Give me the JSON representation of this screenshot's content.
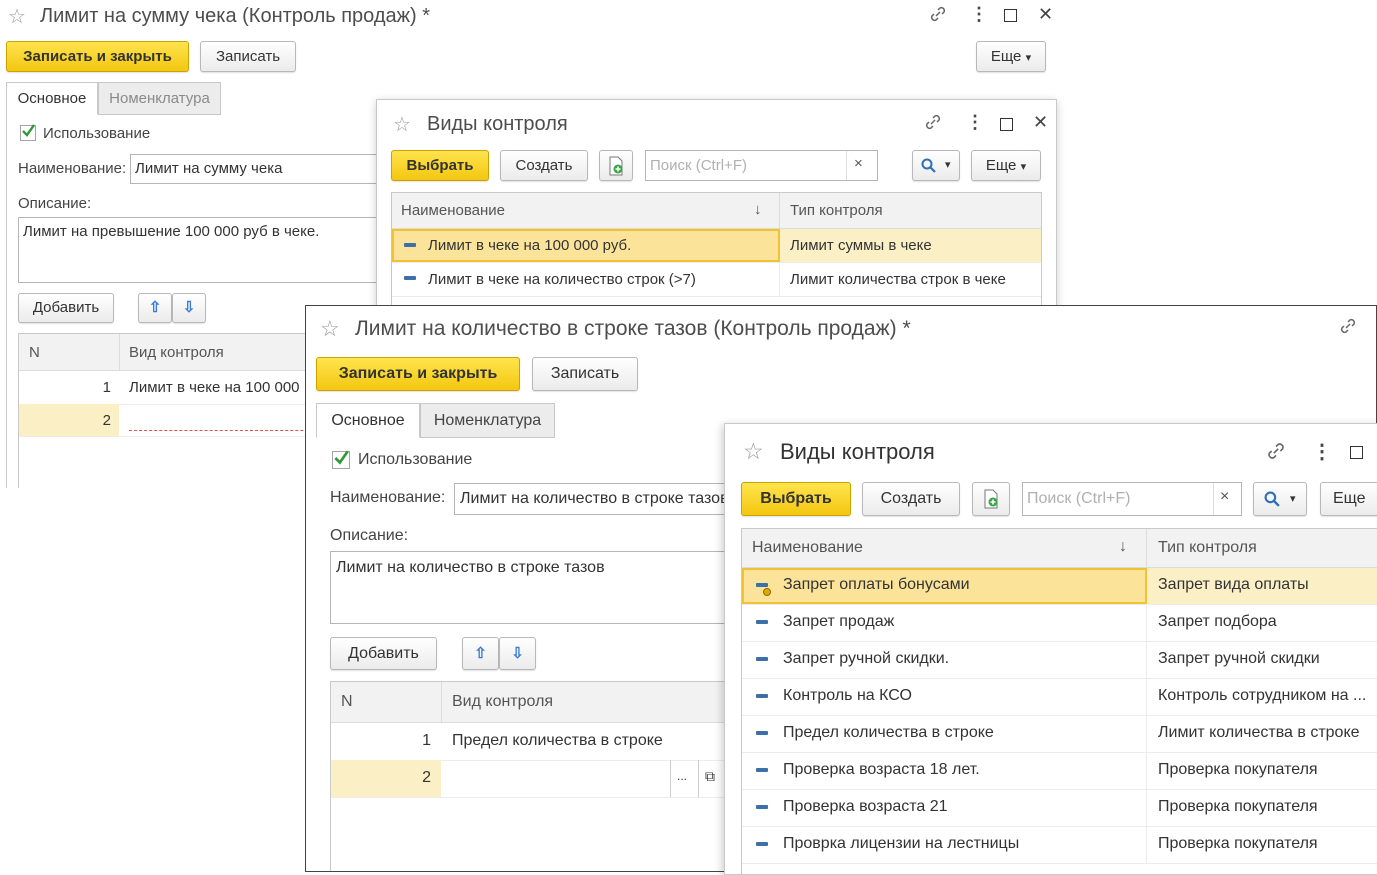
{
  "w1": {
    "title": "Лимит на сумму чека (Контроль продаж) *",
    "save_close": "Записать и закрыть",
    "save": "Записать",
    "more": "Еще",
    "tab_main": "Основное",
    "tab_nomen": "Номенклатура",
    "use_label": "Использование",
    "name_label": "Наименование:",
    "name_value": "Лимит на сумму чека",
    "desc_label": "Описание:",
    "desc_value": "Лимит на превышение 100 000 руб в чеке.",
    "add": "Добавить",
    "col_n": "N",
    "col_kind": "Вид контроля",
    "rows": [
      {
        "n": "1",
        "kind": "Лимит в чеке на 100 000"
      },
      {
        "n": "2",
        "kind": ""
      }
    ]
  },
  "w2": {
    "title": "Виды контроля",
    "select": "Выбрать",
    "create": "Создать",
    "search_placeholder": "Поиск (Ctrl+F)",
    "more": "Еще",
    "col_name": "Наименование",
    "col_type": "Тип контроля",
    "rows": [
      {
        "name": "Лимит в чеке на 100 000 руб.",
        "type": "Лимит суммы в чеке"
      },
      {
        "name": "Лимит в чеке на количество строк (>7)",
        "type": "Лимит количества строк в чеке"
      }
    ]
  },
  "w3": {
    "title": "Лимит на количество в строке тазов (Контроль продаж) *",
    "save_close": "Записать и закрыть",
    "save": "Записать",
    "tab_main": "Основное",
    "tab_nomen": "Номенклатура",
    "use_label": "Использование",
    "name_label": "Наименование:",
    "name_value": "Лимит на количество в строке тазов",
    "desc_label": "Описание:",
    "desc_value": "Лимит на количество в строке тазов",
    "add": "Добавить",
    "col_n": "N",
    "col_kind": "Вид контроля",
    "rows": [
      {
        "n": "1",
        "kind": "Предел количества в строке"
      },
      {
        "n": "2",
        "kind": ""
      }
    ],
    "ellipsis": "..."
  },
  "w4": {
    "title": "Виды контроля",
    "select": "Выбрать",
    "create": "Создать",
    "search_placeholder": "Поиск (Ctrl+F)",
    "more": "Еще",
    "col_name": "Наименование",
    "col_type": "Тип контроля",
    "rows": [
      {
        "name": "Запрет оплаты бонусами",
        "type": "Запрет вида оплаты"
      },
      {
        "name": "Запрет продаж",
        "type": "Запрет подбора"
      },
      {
        "name": "Запрет ручной скидки.",
        "type": "Запрет ручной скидки"
      },
      {
        "name": "Контроль на КСО",
        "type": "Контроль сотрудником на ..."
      },
      {
        "name": "Предел количества в строке",
        "type": "Лимит количества в строке"
      },
      {
        "name": "Проверка возраста 18 лет.",
        "type": "Проверка покупателя"
      },
      {
        "name": "Проверка возраста 21",
        "type": "Проверка покупателя"
      },
      {
        "name": "Проврка лицензии на лестницы",
        "type": "Проверка покупателя"
      }
    ]
  },
  "icons": {
    "star": "☆",
    "link": "🔗",
    "menu": "⋮",
    "maximize": "☐",
    "close": "✕",
    "up": "⇧",
    "down": "⇩",
    "sort": "↓",
    "clear": "×",
    "search": "🔍",
    "caret": "▾",
    "check": "✓",
    "open": "⧉"
  },
  "colors": {
    "accent_yellow": "#f3c711",
    "selection": "#fbe49a",
    "row_icon": "#3d6fa8"
  }
}
